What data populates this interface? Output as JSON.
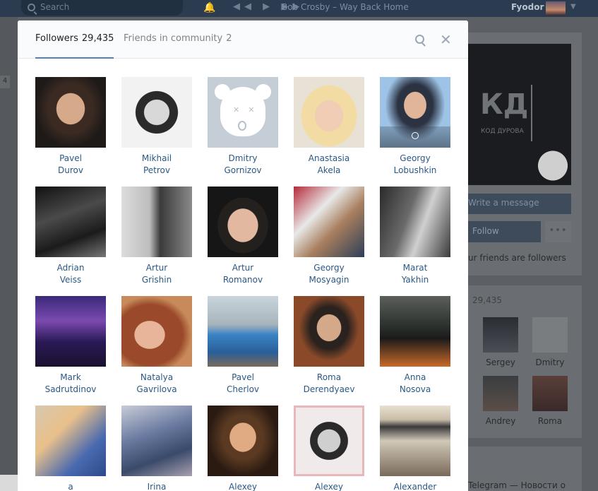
{
  "topbar": {
    "search_placeholder": "Search",
    "player_controls": "◀◀ ▶ ▶▶",
    "track": "Bob Crosby – Way Back Home",
    "user_name": "Fyodor"
  },
  "left_badge": "4",
  "background": {
    "cover_logo": "КД",
    "cover_sub": "КОД ДУРОВА",
    "write_message": "Write a message",
    "follow": "Follow",
    "more": "•••",
    "friends_note": "ur friends are followers",
    "followers_count": "29,435",
    "followers_preview": [
      {
        "name": "Sergey"
      },
      {
        "name": "Dmitry"
      },
      {
        "name": "Andrey"
      },
      {
        "name": "Roma"
      }
    ],
    "telegram": "Telegram — Новости о"
  },
  "modal": {
    "tabs": [
      {
        "label": "Followers",
        "count": "29,435"
      },
      {
        "label": "Friends in community",
        "count": "2"
      }
    ],
    "followers": [
      {
        "first": "Pavel",
        "last": "Durov"
      },
      {
        "first": "Mikhail",
        "last": "Petrov"
      },
      {
        "first": "Dmitry",
        "last": "Gornizov"
      },
      {
        "first": "Anastasia",
        "last": "Akela"
      },
      {
        "first": "Georgy",
        "last": "Lobushkin"
      },
      {
        "first": "Adrian",
        "last": "Veiss"
      },
      {
        "first": "Artur",
        "last": "Grishin"
      },
      {
        "first": "Artur",
        "last": "Romanov"
      },
      {
        "first": "Georgy",
        "last": "Mosyagin"
      },
      {
        "first": "Marat",
        "last": "Yakhin"
      },
      {
        "first": "Mark",
        "last": "Sadrutdinov"
      },
      {
        "first": "Natalya",
        "last": "Gavrilova"
      },
      {
        "first": "Pavel",
        "last": "Cherlov"
      },
      {
        "first": "Roma",
        "last": "Derendyaev"
      },
      {
        "first": "Anna",
        "last": "Nosova"
      },
      {
        "first": "a",
        "last": ""
      },
      {
        "first": "Irina",
        "last": ""
      },
      {
        "first": "Alexey",
        "last": ""
      },
      {
        "first": "Alexey",
        "last": ""
      },
      {
        "first": "Alexander",
        "last": ""
      }
    ]
  }
}
